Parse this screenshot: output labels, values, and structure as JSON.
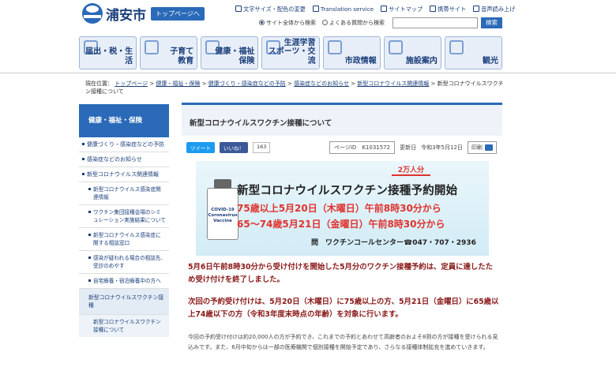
{
  "header": {
    "site_name": "浦安市",
    "top_page_button": "トップページへ",
    "utility": [
      "文字サイズ・配色の変更",
      "Translation service",
      "サイトマップ",
      "携帯サイト",
      "音声読み上げ"
    ],
    "search_options": [
      "サイト全体から検索",
      "よくある質問から検索"
    ],
    "search_placeholder": "",
    "search_button": "検索"
  },
  "nav": [
    {
      "label_1": "",
      "label_2": "届出・税・生活",
      "icon": "document-icon"
    },
    {
      "label_1": "子育て",
      "label_2": "教育",
      "icon": "child-icon"
    },
    {
      "label_1": "健康・福祉",
      "label_2": "保険",
      "icon": "heart-icon"
    },
    {
      "label_1": "生涯学習",
      "label_2": "スポーツ・交流",
      "icon": "sports-icon"
    },
    {
      "label_1": "",
      "label_2": "市政情報",
      "icon": "city-hall-icon"
    },
    {
      "label_1": "",
      "label_2": "施設案内",
      "icon": "facility-icon"
    },
    {
      "label_1": "",
      "label_2": "観光",
      "icon": "tourism-icon"
    }
  ],
  "breadcrumb": {
    "prefix": "現在位置：",
    "items": [
      "トップページ",
      "健康・福祉・保険",
      "健康づくり・感染症などの予防",
      "感染症などのお知らせ",
      "新型コロナウイルス関連情報"
    ],
    "current": "新型コロナウイルスワクチン接種について"
  },
  "sidebar": {
    "heading": "健康・福祉・保険",
    "items": [
      "健康づくり・感染症などの予防",
      "感染症などのお知らせ",
      "新型コロナウイルス関連情報"
    ],
    "sub_items": [
      "新型コロナウイルス感染症関連情報",
      "ワクチン集団接種会場のシミュレーション実施結果について",
      "新型コロナウイルス感染症に関する相談窓口",
      "感染が疑われる場合の相談先、受診のめやす",
      "自宅療養・宿泊療養中の方へ"
    ],
    "active_item": "新型コロナウイルスワクチン接種",
    "active_sub": "新型コロナウイルスワクチン接種について"
  },
  "article": {
    "title": "新型コロナウイルスワクチン接種について",
    "tweet": "ツイート",
    "like": "いいね！",
    "like_count": "163",
    "page_id_label": "ページID",
    "page_id": "K1031572",
    "updated_label": "更新日",
    "updated": "令和3年5月12日",
    "print": "印刷"
  },
  "banner": {
    "tag": "2万人分",
    "headline": "新型コロナウイルスワクチン接種予約開始",
    "line1": "75歳以上5月20日（木曜日）午前8時30分から",
    "line2": "65～74歳5月21日（金曜日）午前8時30分から",
    "contact": "問　ワクチンコールセンター☎047・707・2936",
    "vial_label_1": "COVID-19",
    "vial_label_2": "Coronavirus Vaccine"
  },
  "body": {
    "para1": "5月6日午前8時30分から受け付けを開始した5月分のワクチン接種予約は、定員に達したため受け付けを終了しました。",
    "para2": "次回の予約受け付けは、5月20日（木曜日）に75歳以上の方、5月21日（金曜日）に65歳以上74歳以下の方（令和3年度末時点の年齢）を対象に行います。",
    "para3": "今回の予約受け付けは約20,000人の方が予約でき、これまでの予約とあわせて高齢者のおよそ8割の方が接種を受けられる見込みです。また、6月中旬からは一部の医療機関で個別接種を開始予定であり、さらなる接種体制拡充を進めていきます。"
  },
  "colors": {
    "brand": "#2a6ab8",
    "accent_red": "#e0322d",
    "body_red": "#8a1818"
  }
}
